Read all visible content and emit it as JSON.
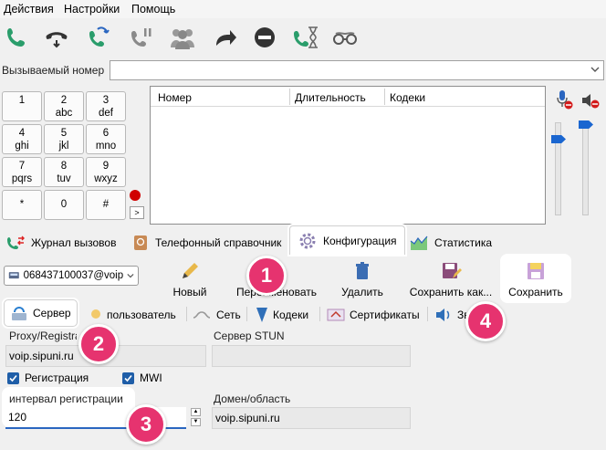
{
  "menu": {
    "actions": "Действия",
    "settings": "Настройки",
    "help": "Помощь"
  },
  "icons": [
    "call-icon",
    "hangup-icon",
    "transfer-icon",
    "hold-icon",
    "conference-icon",
    "forward-icon",
    "dnd-icon",
    "call-later-icon",
    "anonymous-icon"
  ],
  "dial": {
    "label": "Вызываемый номер",
    "value": ""
  },
  "keypad": [
    {
      "n": "1",
      "l": ""
    },
    {
      "n": "2",
      "l": "abc"
    },
    {
      "n": "3",
      "l": "def"
    },
    {
      "n": "4",
      "l": "ghi"
    },
    {
      "n": "5",
      "l": "jkl"
    },
    {
      "n": "6",
      "l": "mno"
    },
    {
      "n": "7",
      "l": "pqrs"
    },
    {
      "n": "8",
      "l": "tuv"
    },
    {
      "n": "9",
      "l": "wxyz"
    },
    {
      "n": "*",
      "l": ""
    },
    {
      "n": "0",
      "l": ""
    },
    {
      "n": "#",
      "l": ""
    }
  ],
  "expand_label": ">",
  "calls": {
    "col_number": "Номер",
    "col_duration": "Длительность",
    "col_codecs": "Кодеки"
  },
  "tabs": {
    "log": "Журнал вызовов",
    "phonebook": "Телефонный справочник",
    "config": "Конфигурация",
    "stats": "Статистика"
  },
  "account": "068437100037@voip",
  "tools": {
    "new": "Новый",
    "rename": "Переименовать",
    "delete": "Удалить",
    "save_as": "Сохранить как...",
    "save": "Сохранить"
  },
  "subtabs": {
    "server": "Сервер",
    "user": "пользователь",
    "network": "Сеть",
    "codecs": "Кодеки",
    "certs": "Сертификаты",
    "sound": "Звук"
  },
  "form": {
    "proxy_label": "Proxy/Registrar",
    "proxy_value": "voip.sipuni.ru",
    "stun_label": "Сервер STUN",
    "stun_value": "",
    "reg_label": "Регистрация",
    "mwi_label": "MWI",
    "interval_label": "интервал регистрации",
    "interval_value": "120",
    "domain_label": "Домен/область",
    "domain_value": "voip.sipuni.ru"
  },
  "badges": [
    "1",
    "2",
    "3",
    "4"
  ],
  "colors": {
    "accent": "#e6336f",
    "checkbox": "#1f5ea8",
    "green": "#2a9d6b"
  }
}
